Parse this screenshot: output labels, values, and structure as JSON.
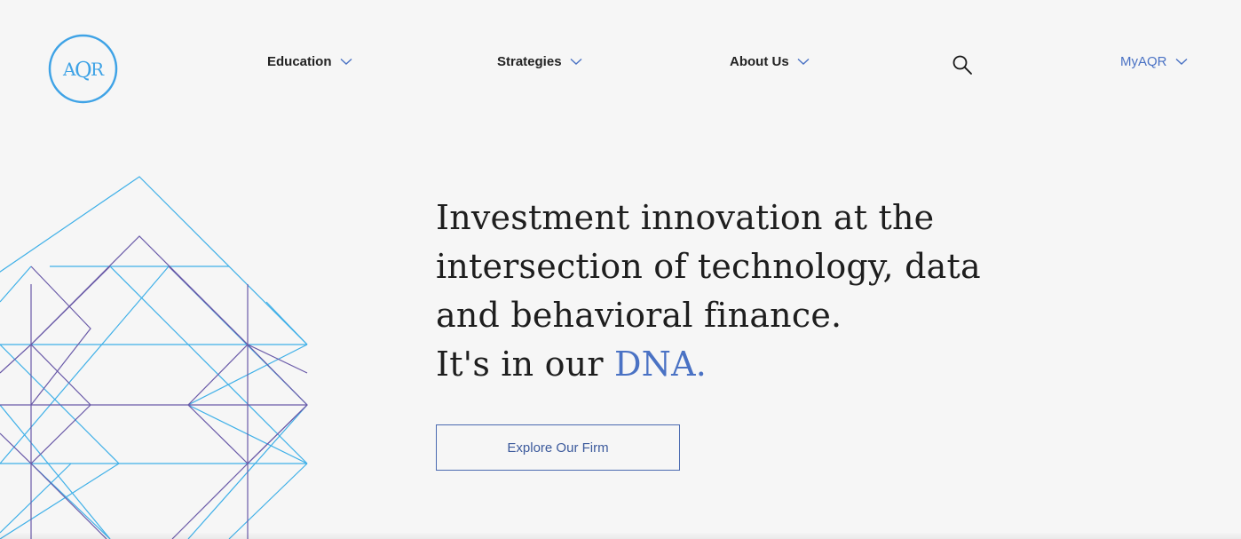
{
  "brand": {
    "logo_text_a": "A",
    "logo_text_q": "Q",
    "logo_text_r": "R",
    "logo_color": "#3fa3e6"
  },
  "nav": {
    "items": [
      {
        "label": "Education",
        "icon": "chevron-down-icon"
      },
      {
        "label": "Strategies",
        "icon": "chevron-down-icon"
      },
      {
        "label": "About Us",
        "icon": "chevron-down-icon"
      }
    ],
    "search_icon": "search-icon",
    "myaqr": {
      "label": "MyAQR",
      "icon": "chevron-down-icon"
    }
  },
  "hero": {
    "line1": "Investment innovation at the",
    "line2": "intersection of technology, data",
    "line3": "and behavioral finance.",
    "line4_prefix": "It's in our ",
    "line4_accent": "DNA."
  },
  "cta": {
    "label": "Explore Our Firm"
  },
  "colors": {
    "background": "#f6f6f6",
    "accent_blue": "#4a72c4",
    "art_light_blue": "#3fb0e8",
    "art_purple": "#6a5aa8"
  }
}
